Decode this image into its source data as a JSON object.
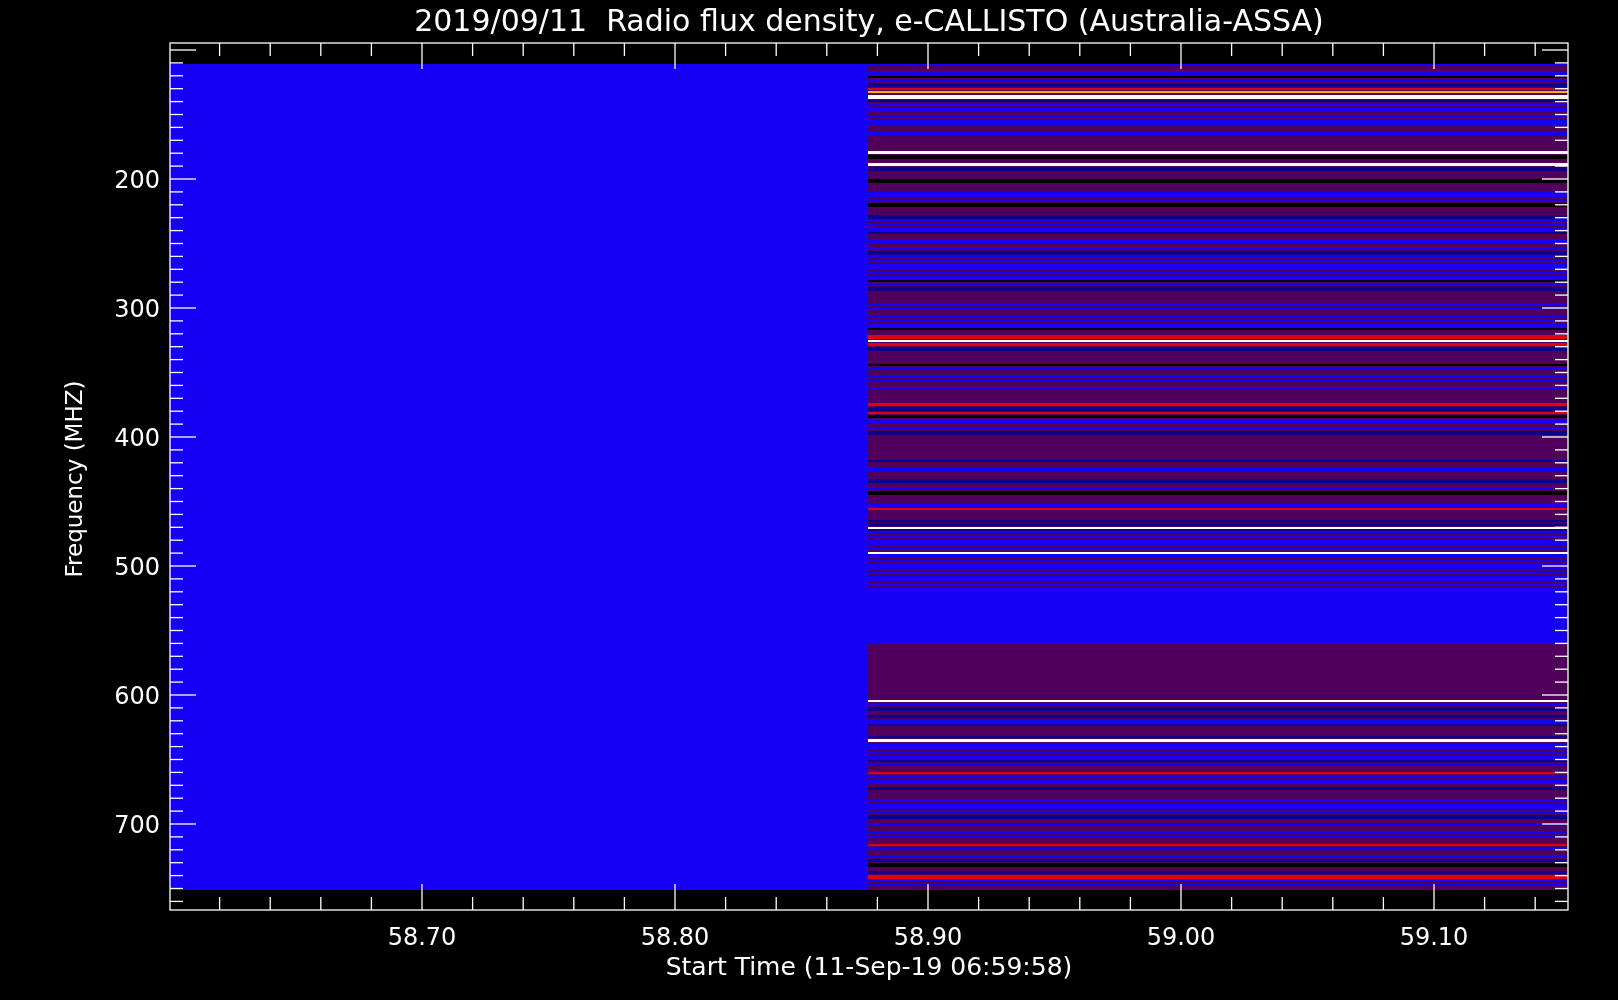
{
  "title": "2019/09/11  Radio flux density, e-CALLISTO (Australia-ASSA)",
  "y_axis": {
    "label": "Frequency (MHZ)",
    "ticks": [
      "200",
      "300",
      "400",
      "500",
      "600",
      "700"
    ]
  },
  "x_axis": {
    "label": "Start Time (11-Sep-19 06:59:58)",
    "ticks": [
      "58.70",
      "58.80",
      "58.90",
      "59.00",
      "59.10"
    ]
  }
}
